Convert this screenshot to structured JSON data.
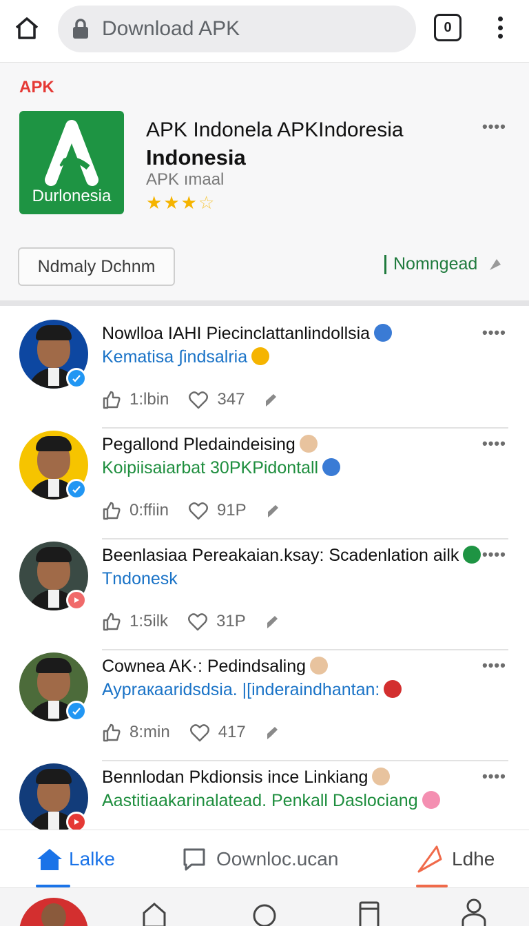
{
  "browser": {
    "url_text": "Download APK",
    "tab_count": "0"
  },
  "app": {
    "tag": "APK",
    "icon_label": "Durlonesia",
    "title_line1": "APK Indonela APKIndoresia",
    "title_line2": "Indonesia",
    "subtitle": "APK ımaal",
    "rating_stars": 3.5,
    "secondary_button": "Ndmaly Dchnm",
    "download_label": "Nomngead",
    "brand_color": "#1e9443"
  },
  "posts": [
    {
      "title": "Nowlloa IAHI Piecinclattanlindollsia",
      "subtitle": "Kematisa ∫indsalria",
      "subtitle_color": "#1a73c7",
      "likes": "1:lbin",
      "comments": "347",
      "avatar_bg": "#0d47a1",
      "badge": "verified-icon",
      "badge_color": "#2196f3"
    },
    {
      "title": "Pegallond Pledaindeising",
      "subtitle": "Koipiisaiarbat 30PKPidontall",
      "subtitle_color": "#1e8e3e",
      "likes": "0:ffiin",
      "comments": "91P",
      "avatar_bg": "#f6c400",
      "badge": "verified-icon",
      "badge_color": "#2196f3"
    },
    {
      "title": "Beenlasiaa Pereakaian.ksay: Scadenlation ailk",
      "subtitle": "Tndonesk",
      "subtitle_color": "#1a73c7",
      "likes": "1:5ilk",
      "comments": "31P",
      "avatar_bg": "#3a4a44",
      "badge": "play-icon",
      "badge_color": "#f06a6a"
    },
    {
      "title": "Cownea AK·: Pedindsaling",
      "subtitle": "Aypraкaaridsdsia. |[inderaindhantan:",
      "subtitle_color": "#1a73c7",
      "likes": "8:min",
      "comments": "417",
      "avatar_bg": "#4c6b3a",
      "badge": "verified-icon",
      "badge_color": "#2196f3"
    },
    {
      "title": "Bennlodan Pkdionsis ince Linkiang",
      "subtitle": "Aastitiaakarinalatead. Penkall Daslociang",
      "subtitle_color": "#1e8e3e",
      "likes": "",
      "comments": "",
      "avatar_bg": "#123c7a",
      "badge": "play-icon",
      "badge_color": "#e53935"
    }
  ],
  "tabs": [
    {
      "label": "Lalke",
      "color": "#1a73e8",
      "icon": "home-icon"
    },
    {
      "label": "Oownloc.ucan",
      "color": "#5f6368",
      "icon": "comment-icon"
    },
    {
      "label": "Ldhe",
      "color": "#5f6368",
      "icon": "send-icon"
    }
  ],
  "navbar": {
    "icons": [
      "profile-avatar-icon",
      "home-outline-icon",
      "circle-icon",
      "recent-apps-icon",
      "person-icon"
    ]
  }
}
